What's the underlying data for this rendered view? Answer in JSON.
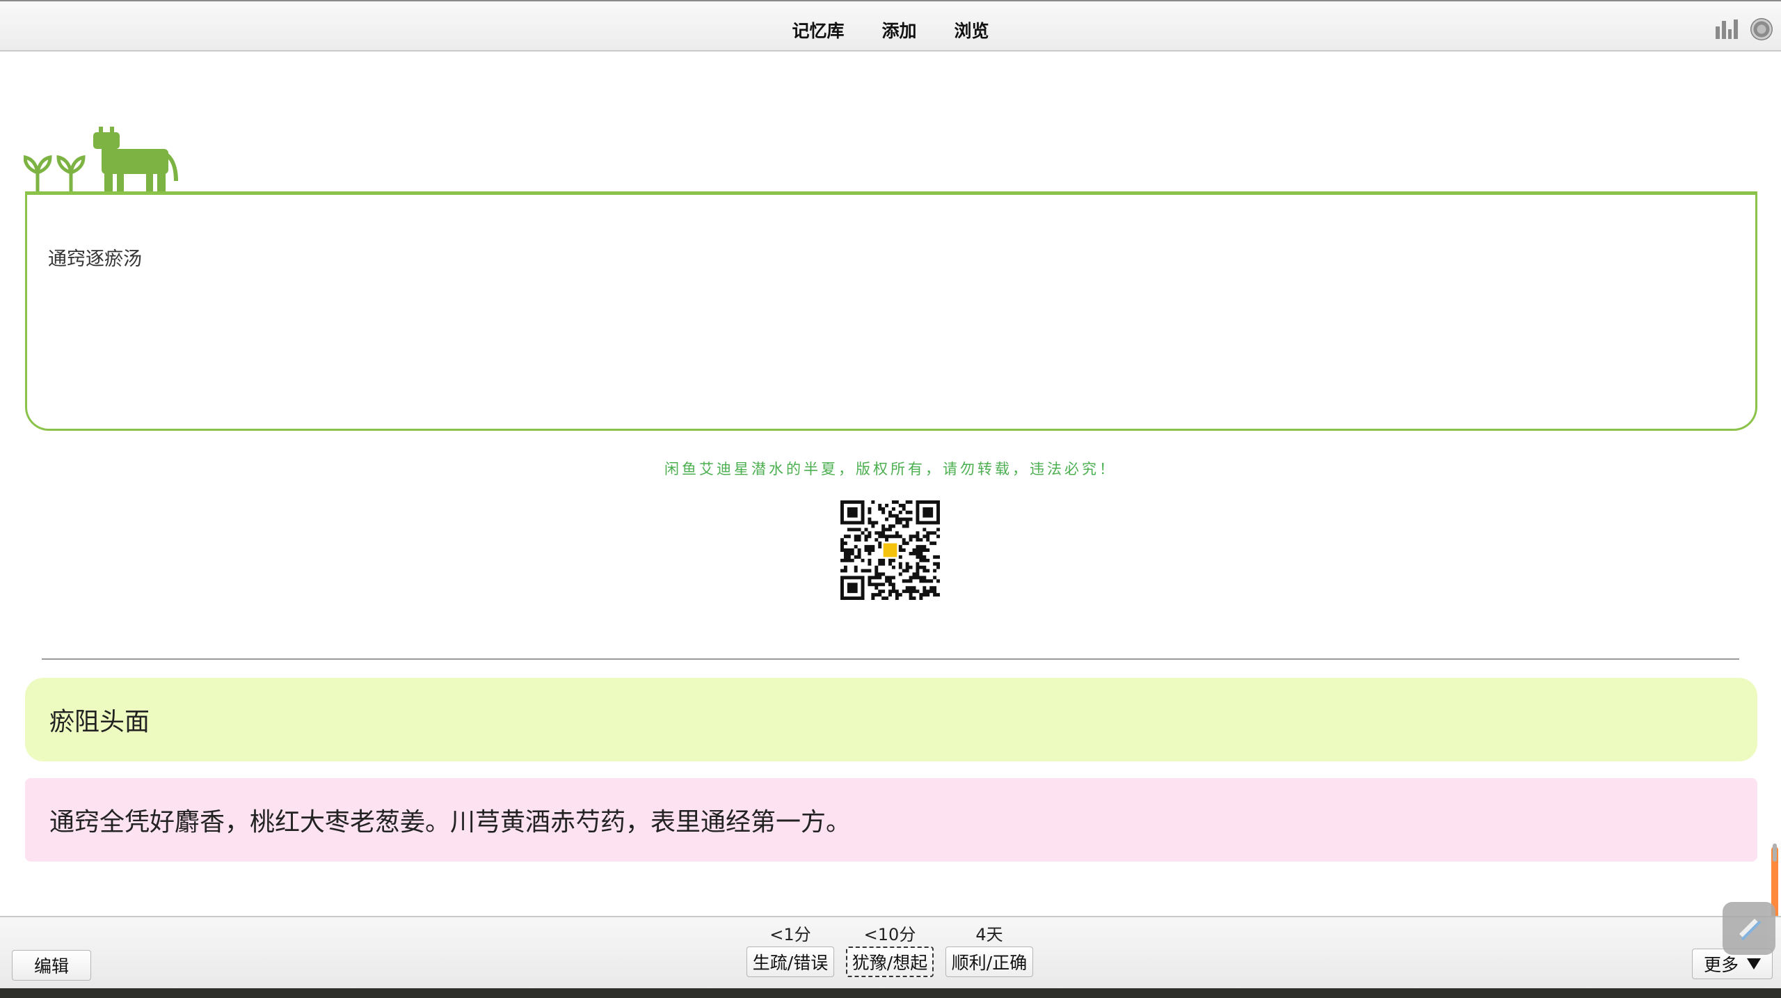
{
  "toolbar": {
    "nav": [
      "记忆库",
      "添加",
      "浏览"
    ]
  },
  "card": {
    "front_text": "通窍逐瘀汤",
    "copyright": "闲鱼艾迪星潜水的半夏，版权所有，请勿转载，违法必究！",
    "answers": {
      "first": "瘀阻头面",
      "second": "通窍全凭好麝香，桃红大枣老葱姜。川芎黄酒赤芍药，表里通经第一方。"
    }
  },
  "reviewer": {
    "edit_label": "编辑",
    "more_label": "更多",
    "ease_buttons": [
      {
        "interval": "<1分",
        "label": "生疏/错误"
      },
      {
        "interval": "<10分",
        "label": "犹豫/想起"
      },
      {
        "interval": "4天",
        "label": "顺利/正确"
      }
    ]
  },
  "colors": {
    "accent_green": "#8bc34a",
    "answer_green_bg": "#edfbc1",
    "answer_pink_bg": "#fde2f1",
    "copyright_green": "#4caf50"
  },
  "icons": [
    "stats-icon",
    "sync-icon",
    "cow-icon",
    "sprout-icon",
    "qr-code-icon",
    "scroll-widget-icon",
    "chevron-down-icon"
  ]
}
